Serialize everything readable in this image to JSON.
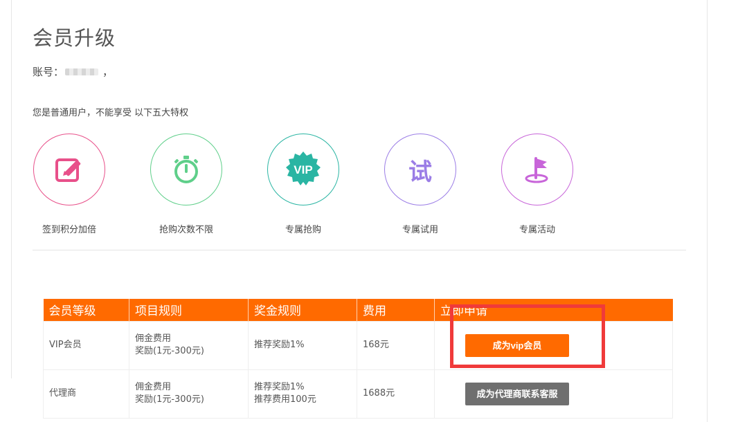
{
  "page": {
    "title": "会员升级",
    "account_label": "账号：",
    "account_suffix": "，",
    "notice": "您是普通用户，不能享受 以下五大特权"
  },
  "perks": [
    {
      "label": "签到积分加倍",
      "icon": "edit-icon",
      "color": "#e8508a"
    },
    {
      "label": "抢购次数不限",
      "icon": "stopwatch-icon",
      "color": "#5fcf8a"
    },
    {
      "label": "专属抢购",
      "icon": "vip-badge-icon",
      "color": "#2ab5a3",
      "badge_text": "VIP"
    },
    {
      "label": "专属试用",
      "icon": "trial-icon",
      "color": "#9b7de6",
      "badge_text": "试"
    },
    {
      "label": "专属活动",
      "icon": "flag-icon",
      "color": "#c865d9"
    }
  ],
  "table": {
    "headers": [
      "会员等级",
      "项目规则",
      "奖金规则",
      "费用",
      "立即申请"
    ],
    "rows": [
      {
        "level": "VIP会员",
        "project_rule": [
          "佣金费用",
          "奖励(1元-300元)"
        ],
        "bonus_rule": [
          "推荐奖励1%"
        ],
        "fee": "168元",
        "button": "成为vip会员"
      },
      {
        "level": "代理商",
        "project_rule": [
          "佣金费用",
          "奖励(1元-300元)"
        ],
        "bonus_rule": [
          "推荐奖励1%",
          "推荐费用100元"
        ],
        "fee": "1688元",
        "button": "成为代理商联系客服"
      }
    ]
  },
  "colors": {
    "accent": "#ff6a00",
    "highlight": "#f03a3a",
    "gray_button": "#6f6f6f"
  }
}
